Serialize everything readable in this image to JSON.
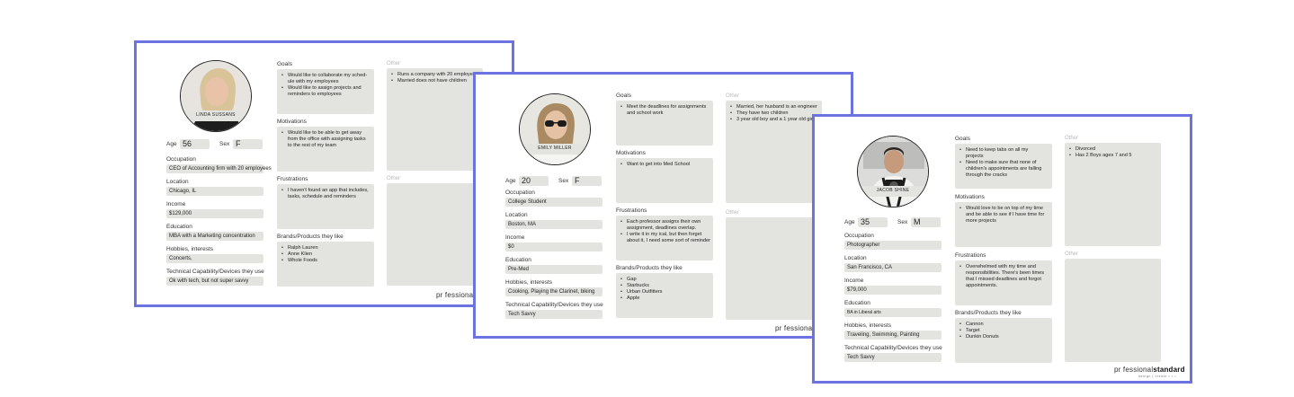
{
  "brand": {
    "name_prefix": "pr fessional",
    "name_bold": "standard",
    "tagline": "design | create • • •"
  },
  "labels": {
    "age": "Age",
    "sex": "Sex",
    "occupation": "Occupation",
    "location": "Location",
    "income": "Income",
    "education": "Education",
    "hobbies": "Hobbies, interests",
    "tech": "Technical Capability/Devices they use",
    "goals": "Goals",
    "motivations": "Motivations",
    "frustrations": "Frustrations",
    "brands": "Brands/Products they like",
    "other": "Other"
  },
  "personas": [
    {
      "name": "LINDA SUSSANS",
      "age": "56",
      "sex": "F",
      "occupation": "CEO of Accounting firm with 20 employees",
      "location": "Chicago, IL",
      "income": "$129,000",
      "education": "MBA with a Marketing concentration",
      "hobbies": "Concerts,",
      "tech": "Ok with tech, but not super savvy",
      "goals": [
        "Would like to collaborate my sched-ule with my employees",
        "Would like to assign projects and reminders to employees"
      ],
      "motivations": [
        "Would like to be able to get away from the office with assigning tasks to the rest of my team"
      ],
      "frustrations": [
        "I haven't found an app that includes, tasks, schedule and reminders"
      ],
      "brands": [
        "Ralph Lauren",
        "Anne Klien",
        "Whole Foods"
      ],
      "other": [
        "Runs a company with 20 employees",
        "Married does not have children"
      ]
    },
    {
      "name": "EMILY MILLER",
      "age": "20",
      "sex": "F",
      "occupation": "College Student",
      "location": "Boston, MA",
      "income": "$0",
      "education": "Pre-Med",
      "hobbies": "Cooking, Playing the Clarinet, biking",
      "tech": "Tech Savvy",
      "goals": [
        "Meet the deadlines for assignments and school work"
      ],
      "motivations": [
        "Want to get into Med School"
      ],
      "frustrations": [
        "Each professor assigns their own assignment, deadlines overlap.",
        "I write it in my ical, but then forget about it, I need some sort of reminder"
      ],
      "brands": [
        "Gap",
        "Starbucks",
        "Urban Outfitters",
        "Apple"
      ],
      "other": [
        "Married, her husband is an engineer",
        "They have two children",
        "3 year old boy and a 1 year old girl"
      ]
    },
    {
      "name": "JACOB SHINE",
      "age": "35",
      "sex": "M",
      "occupation": "Photographer",
      "location": "San Francisco, CA",
      "income": "$79,000",
      "education": "BA in Liberal arts",
      "hobbies": "Traveling, Swimming, Painting",
      "tech": "Tech Savvy",
      "goals": [
        "Need to keep tabs on all my projects",
        "Need to make sure that none of children's appointments are falling through the cracks"
      ],
      "motivations": [
        "Would love to be on top of my time and be able to see if I have time for more projects"
      ],
      "frustrations": [
        "Overwhelmed with my time and responsibilities. There's been times that I missed deadlines and forgot appointments."
      ],
      "brands": [
        "Cannon",
        "Target",
        "Dunkin Donuts"
      ],
      "other": [
        "Divorced",
        "Has 2 Boys ages 7 and 5"
      ]
    }
  ]
}
